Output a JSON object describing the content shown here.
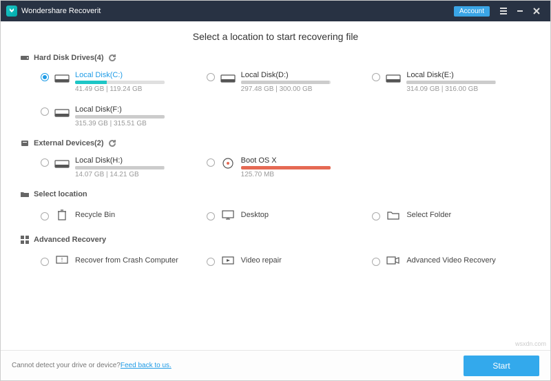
{
  "titlebar": {
    "app_name": "Wondershare Recoverit",
    "account": "Account"
  },
  "heading": "Select a location to start recovering file",
  "sections": {
    "hdd": {
      "label": "Hard Disk Drives(4)"
    },
    "ext": {
      "label": "External Devices(2)"
    },
    "loc": {
      "label": "Select location"
    },
    "adv": {
      "label": "Advanced Recovery"
    }
  },
  "drives": {
    "c": {
      "name": "Local Disk(C:)",
      "size": "41.49 GB | 119.24 GB",
      "pct": 35,
      "color": "#1ec6c6",
      "selected": true
    },
    "d": {
      "name": "Local Disk(D:)",
      "size": "297.48 GB | 300.00 GB",
      "pct": 99,
      "color": "#cccccc"
    },
    "e": {
      "name": "Local Disk(E:)",
      "size": "314.09 GB | 316.00 GB",
      "pct": 99,
      "color": "#cccccc"
    },
    "f": {
      "name": "Local Disk(F:)",
      "size": "315.39 GB | 315.51 GB",
      "pct": 100,
      "color": "#cccccc"
    },
    "h": {
      "name": "Local Disk(H:)",
      "size": "14.07 GB | 14.21 GB",
      "pct": 99,
      "color": "#cccccc"
    },
    "boot": {
      "name": "Boot OS X",
      "size": "125.70 MB",
      "pct": 100,
      "color": "#e56a54"
    }
  },
  "locations": {
    "recycle": "Recycle Bin",
    "desktop": "Desktop",
    "folder": "Select Folder"
  },
  "advanced": {
    "crash": "Recover from Crash Computer",
    "video": "Video repair",
    "advvideo": "Advanced Video Recovery"
  },
  "footer": {
    "text": "Cannot detect your drive or device? ",
    "link": "Feed back to us.",
    "start": "Start"
  },
  "watermark": "wsxdn.com"
}
